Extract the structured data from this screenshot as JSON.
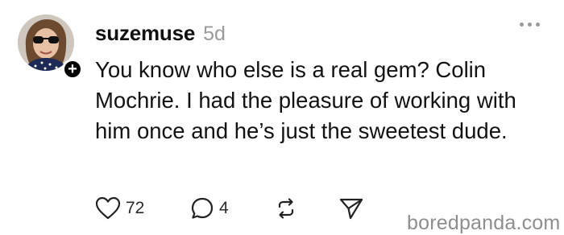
{
  "post": {
    "username": "suzemuse",
    "timestamp": "5d",
    "body": "You know who else is a real gem? Colin Mochrie. I had the pleasure of working with him once and he’s just the sweetest dude.",
    "follow_symbol": "+",
    "actions": {
      "likes": "72",
      "replies": "4"
    }
  },
  "icons": {
    "like": "heart-icon",
    "reply": "speech-bubble-icon",
    "repost": "repost-arrows-icon",
    "share": "paper-plane-icon",
    "more": "more-dots-icon"
  },
  "watermark": "boredpanda.com",
  "colors": {
    "text": "#101010",
    "muted": "#9a9a9a",
    "watermark": "#8e8e8e"
  }
}
